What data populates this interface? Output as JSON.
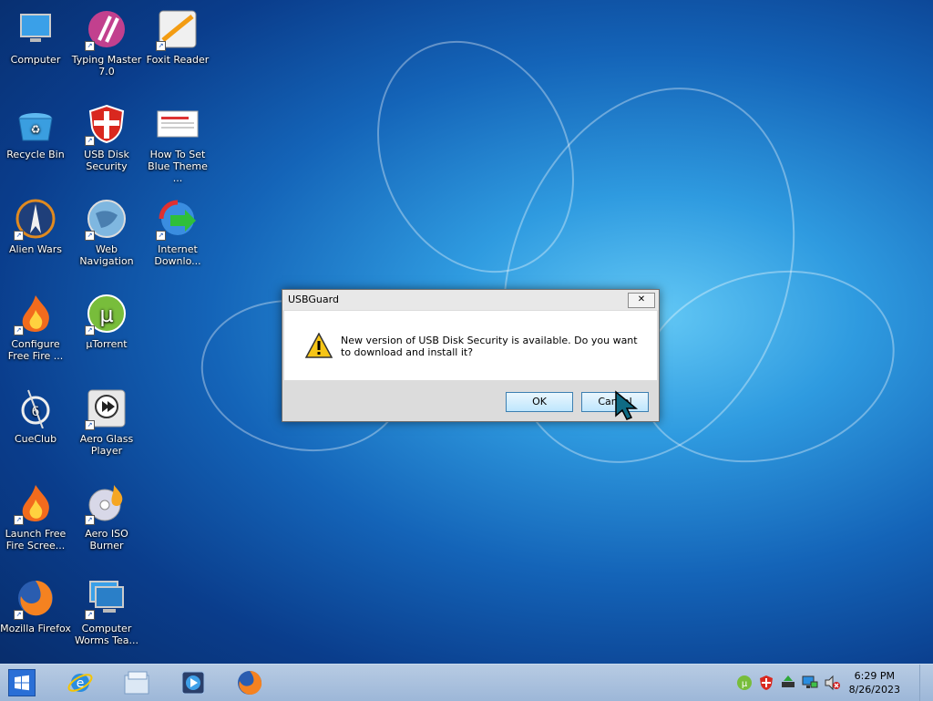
{
  "desktop": {
    "icons": [
      {
        "label": "Computer"
      },
      {
        "label": "Typing Master 7.0"
      },
      {
        "label": "Foxit Reader"
      },
      {
        "label": "Recycle Bin"
      },
      {
        "label": "USB Disk Security"
      },
      {
        "label": "How To Set Blue Theme ..."
      },
      {
        "label": "Alien Wars"
      },
      {
        "label": "Web Navigation"
      },
      {
        "label": "Internet Downlo..."
      },
      {
        "label": "Configure Free Fire ..."
      },
      {
        "label": "µTorrent"
      },
      {
        "label": "CueClub"
      },
      {
        "label": "Aero Glass Player"
      },
      {
        "label": "Launch Free Fire Scree..."
      },
      {
        "label": "Aero ISO Burner"
      },
      {
        "label": "Mozilla Firefox"
      },
      {
        "label": "Computer Worms Tea..."
      }
    ]
  },
  "dialog": {
    "title": "USBGuard",
    "close_label": "✕",
    "message": "New version of USB Disk Security is available. Do you want to download and install it?",
    "ok_label": "OK",
    "cancel_label": "Cancel",
    "icon": "warning-icon"
  },
  "taskbar": {
    "start_icon": "windows-logo-icon",
    "pinned": [
      "internet-explorer-icon",
      "file-explorer-icon",
      "media-player-icon",
      "firefox-icon"
    ],
    "tray_icons": [
      "utorrent-tray-icon",
      "usb-security-tray-icon",
      "network-share-tray-icon",
      "network-tray-icon",
      "volume-muted-tray-icon"
    ],
    "clock": {
      "time": "6:29 PM",
      "date": "8/26/2023"
    }
  },
  "colors": {
    "desktop_blue": "#1464b8",
    "taskbar": "#a9c0dd",
    "button_border": "#3c7fb1"
  }
}
